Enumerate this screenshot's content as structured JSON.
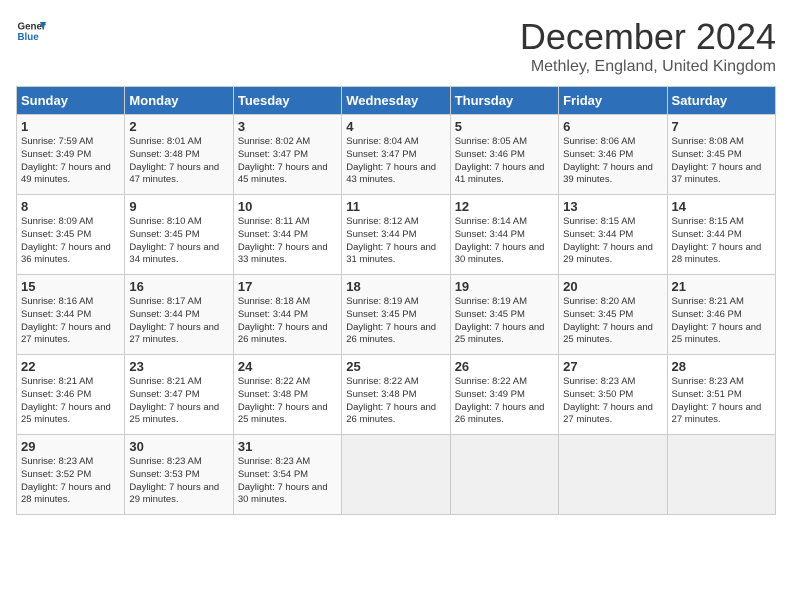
{
  "logo": {
    "text_general": "General",
    "text_blue": "Blue"
  },
  "header": {
    "month": "December 2024",
    "location": "Methley, England, United Kingdom"
  },
  "days_of_week": [
    "Sunday",
    "Monday",
    "Tuesday",
    "Wednesday",
    "Thursday",
    "Friday",
    "Saturday"
  ],
  "weeks": [
    [
      {
        "day": 1,
        "sunrise": "7:59 AM",
        "sunset": "3:49 PM",
        "daylight": "7 hours and 49 minutes."
      },
      {
        "day": 2,
        "sunrise": "8:01 AM",
        "sunset": "3:48 PM",
        "daylight": "7 hours and 47 minutes."
      },
      {
        "day": 3,
        "sunrise": "8:02 AM",
        "sunset": "3:47 PM",
        "daylight": "7 hours and 45 minutes."
      },
      {
        "day": 4,
        "sunrise": "8:04 AM",
        "sunset": "3:47 PM",
        "daylight": "7 hours and 43 minutes."
      },
      {
        "day": 5,
        "sunrise": "8:05 AM",
        "sunset": "3:46 PM",
        "daylight": "7 hours and 41 minutes."
      },
      {
        "day": 6,
        "sunrise": "8:06 AM",
        "sunset": "3:46 PM",
        "daylight": "7 hours and 39 minutes."
      },
      {
        "day": 7,
        "sunrise": "8:08 AM",
        "sunset": "3:45 PM",
        "daylight": "7 hours and 37 minutes."
      }
    ],
    [
      {
        "day": 8,
        "sunrise": "8:09 AM",
        "sunset": "3:45 PM",
        "daylight": "7 hours and 36 minutes."
      },
      {
        "day": 9,
        "sunrise": "8:10 AM",
        "sunset": "3:45 PM",
        "daylight": "7 hours and 34 minutes."
      },
      {
        "day": 10,
        "sunrise": "8:11 AM",
        "sunset": "3:44 PM",
        "daylight": "7 hours and 33 minutes."
      },
      {
        "day": 11,
        "sunrise": "8:12 AM",
        "sunset": "3:44 PM",
        "daylight": "7 hours and 31 minutes."
      },
      {
        "day": 12,
        "sunrise": "8:14 AM",
        "sunset": "3:44 PM",
        "daylight": "7 hours and 30 minutes."
      },
      {
        "day": 13,
        "sunrise": "8:15 AM",
        "sunset": "3:44 PM",
        "daylight": "7 hours and 29 minutes."
      },
      {
        "day": 14,
        "sunrise": "8:15 AM",
        "sunset": "3:44 PM",
        "daylight": "7 hours and 28 minutes."
      }
    ],
    [
      {
        "day": 15,
        "sunrise": "8:16 AM",
        "sunset": "3:44 PM",
        "daylight": "7 hours and 27 minutes."
      },
      {
        "day": 16,
        "sunrise": "8:17 AM",
        "sunset": "3:44 PM",
        "daylight": "7 hours and 27 minutes."
      },
      {
        "day": 17,
        "sunrise": "8:18 AM",
        "sunset": "3:44 PM",
        "daylight": "7 hours and 26 minutes."
      },
      {
        "day": 18,
        "sunrise": "8:19 AM",
        "sunset": "3:45 PM",
        "daylight": "7 hours and 26 minutes."
      },
      {
        "day": 19,
        "sunrise": "8:19 AM",
        "sunset": "3:45 PM",
        "daylight": "7 hours and 25 minutes."
      },
      {
        "day": 20,
        "sunrise": "8:20 AM",
        "sunset": "3:45 PM",
        "daylight": "7 hours and 25 minutes."
      },
      {
        "day": 21,
        "sunrise": "8:21 AM",
        "sunset": "3:46 PM",
        "daylight": "7 hours and 25 minutes."
      }
    ],
    [
      {
        "day": 22,
        "sunrise": "8:21 AM",
        "sunset": "3:46 PM",
        "daylight": "7 hours and 25 minutes."
      },
      {
        "day": 23,
        "sunrise": "8:21 AM",
        "sunset": "3:47 PM",
        "daylight": "7 hours and 25 minutes."
      },
      {
        "day": 24,
        "sunrise": "8:22 AM",
        "sunset": "3:48 PM",
        "daylight": "7 hours and 25 minutes."
      },
      {
        "day": 25,
        "sunrise": "8:22 AM",
        "sunset": "3:48 PM",
        "daylight": "7 hours and 26 minutes."
      },
      {
        "day": 26,
        "sunrise": "8:22 AM",
        "sunset": "3:49 PM",
        "daylight": "7 hours and 26 minutes."
      },
      {
        "day": 27,
        "sunrise": "8:23 AM",
        "sunset": "3:50 PM",
        "daylight": "7 hours and 27 minutes."
      },
      {
        "day": 28,
        "sunrise": "8:23 AM",
        "sunset": "3:51 PM",
        "daylight": "7 hours and 27 minutes."
      }
    ],
    [
      {
        "day": 29,
        "sunrise": "8:23 AM",
        "sunset": "3:52 PM",
        "daylight": "7 hours and 28 minutes."
      },
      {
        "day": 30,
        "sunrise": "8:23 AM",
        "sunset": "3:53 PM",
        "daylight": "7 hours and 29 minutes."
      },
      {
        "day": 31,
        "sunrise": "8:23 AM",
        "sunset": "3:54 PM",
        "daylight": "7 hours and 30 minutes."
      },
      null,
      null,
      null,
      null
    ]
  ]
}
